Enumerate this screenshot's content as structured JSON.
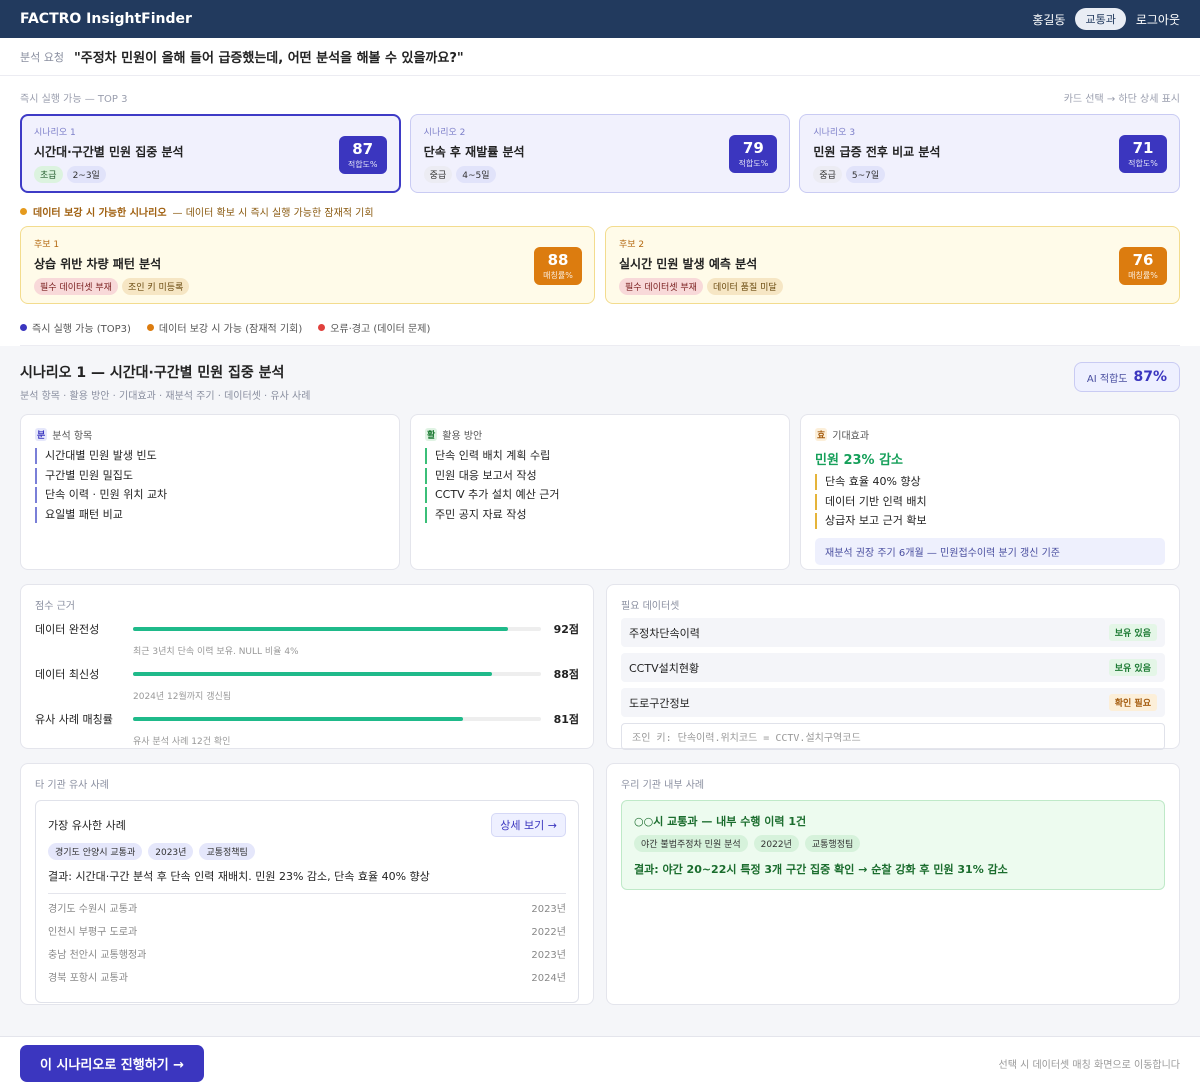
{
  "header": {
    "logo": "FACTRO InsightFinder",
    "user": "홍길동",
    "dept": "교통과",
    "logout": "로그아웃"
  },
  "request": {
    "label": "분석 요청",
    "question": "\"주정차 민원이 올해 들어 급증했는데, 어떤 분석을 해볼 수 있을까요?\""
  },
  "top3": {
    "heading": "즉시 실행 가능 — TOP 3",
    "hint": "카드 선택 → 하단 상세 표시",
    "cards": [
      {
        "tag": "시나리오 1",
        "title": "시간대·구간별 민원 집중 분석",
        "level": "초급",
        "duration": "2~3일",
        "score": "87",
        "unit": "적합도%"
      },
      {
        "tag": "시나리오 2",
        "title": "단속 후 재발률 분석",
        "level": "중급",
        "duration": "4~5일",
        "score": "79",
        "unit": "적합도%"
      },
      {
        "tag": "시나리오 3",
        "title": "민원 급증 전후 비교 분석",
        "level": "중급",
        "duration": "5~7일",
        "score": "71",
        "unit": "적합도%"
      }
    ]
  },
  "candidates": {
    "heading": "데이터 보강 시 가능한 시나리오",
    "subheading": "— 데이터 확보 시 즉시 실행 가능한 잠재적 기회",
    "cards": [
      {
        "tag": "후보 1",
        "title": "상습 위반 차량 패턴 분석",
        "chip1": "필수 데이터셋 부재",
        "chip2": "조인 키 미등록",
        "score": "88",
        "unit": "매칭률%"
      },
      {
        "tag": "후보 2",
        "title": "실시간 민원 발생 예측 분석",
        "chip1": "필수 데이터셋 부재",
        "chip2": "데이터 품질 미달",
        "score": "76",
        "unit": "매칭률%"
      }
    ]
  },
  "legend": {
    "a": "즉시 실행 가능 (TOP3)",
    "b": "데이터 보강 시 가능 (잠재적 기회)",
    "c": "오류·경고 (데이터 문제)",
    "colors": {
      "a": "#3b36bf",
      "b": "#dc7c0f",
      "c": "#e0403c"
    }
  },
  "detail": {
    "title": "시나리오 1 — 시간대·구간별 민원 집중 분석",
    "subtitle": "분석 항목 · 활용 방안 · 기대효과 · 재분석 주기 · 데이터셋 · 유사 사례",
    "ai_label": "AI 적합도",
    "ai_value": "87%",
    "items": {
      "icon": "분",
      "title": "분석 항목",
      "list": [
        "시간대별 민원 발생 빈도",
        "구간별 민원 밀집도",
        "단속 이력 · 민원 위치 교차",
        "요일별 패턴 비교"
      ]
    },
    "usage": {
      "icon": "활",
      "title": "활용 방안",
      "list": [
        "단속 인력 배치 계획 수립",
        "민원 대응 보고서 작성",
        "CCTV 추가 설치 예산 근거",
        "주민 공지 자료 작성"
      ]
    },
    "effect": {
      "icon": "효",
      "title": "기대효과",
      "headline": "민원 23% 감소",
      "list": [
        "단속 효율 40% 향상",
        "데이터 기반 인력 배치",
        "상급자 보고 근거 확보"
      ],
      "recheck": "재분석 권장 주기  6개월 — 민원접수이력 분기 갱신 기준"
    },
    "scores": {
      "title": "점수 근거",
      "rows": [
        {
          "label": "데이터 완전성",
          "value": 92,
          "text": "92점",
          "note": "최근 3년치 단속 이력 보유. NULL 비율 4%"
        },
        {
          "label": "데이터 최신성",
          "value": 88,
          "text": "88점",
          "note": "2024년 12월까지 갱신됨"
        },
        {
          "label": "유사 사례 매칭률",
          "value": 81,
          "text": "81점",
          "note": "유사 분석 사례 12건 확인"
        }
      ]
    },
    "datasets": {
      "title": "필요 데이터셋",
      "rows": [
        {
          "name": "주정차단속이력",
          "status": "보유 있음",
          "kind": "ok"
        },
        {
          "name": "CCTV설치현황",
          "status": "보유 있음",
          "kind": "ok"
        },
        {
          "name": "도로구간정보",
          "status": "확인 필요",
          "kind": "warn"
        }
      ],
      "joinkey": "조인 키: 단속이력.위치코드 = CCTV.설치구역코드"
    },
    "external": {
      "title": "타 기관 유사 사례",
      "best_label": "가장 유사한 사례",
      "detail_btn": "상세 보기 →",
      "pills": [
        "경기도 안양시 교통과",
        "2023년",
        "교통정책팀"
      ],
      "result": "결과: 시간대·구간 분석 후 단속 인력 재배치. 민원 23% 감소, 단속 효율 40% 향상",
      "others": [
        {
          "org": "경기도 수원시 교통과",
          "year": "2023년"
        },
        {
          "org": "인천시 부평구 도로과",
          "year": "2022년"
        },
        {
          "org": "충남 천안시 교통행정과",
          "year": "2023년"
        },
        {
          "org": "경북 포항시 교통과",
          "year": "2024년"
        }
      ]
    },
    "internal": {
      "title": "우리 기관 내부 사례",
      "heading": "○○시 교통과 — 내부 수행 이력 1건",
      "pills": [
        "야간 불법주정차 민원 분석",
        "2022년",
        "교통행정팀"
      ],
      "result": "결과: 야간 20~22시 특정 3개 구간 집중 확인 → 순찰 강화 후 민원 31% 감소"
    }
  },
  "footer": {
    "button": "이 시나리오로 진행하기 →",
    "note": "선택 시 데이터셋 매칭 화면으로 이동합니다"
  }
}
